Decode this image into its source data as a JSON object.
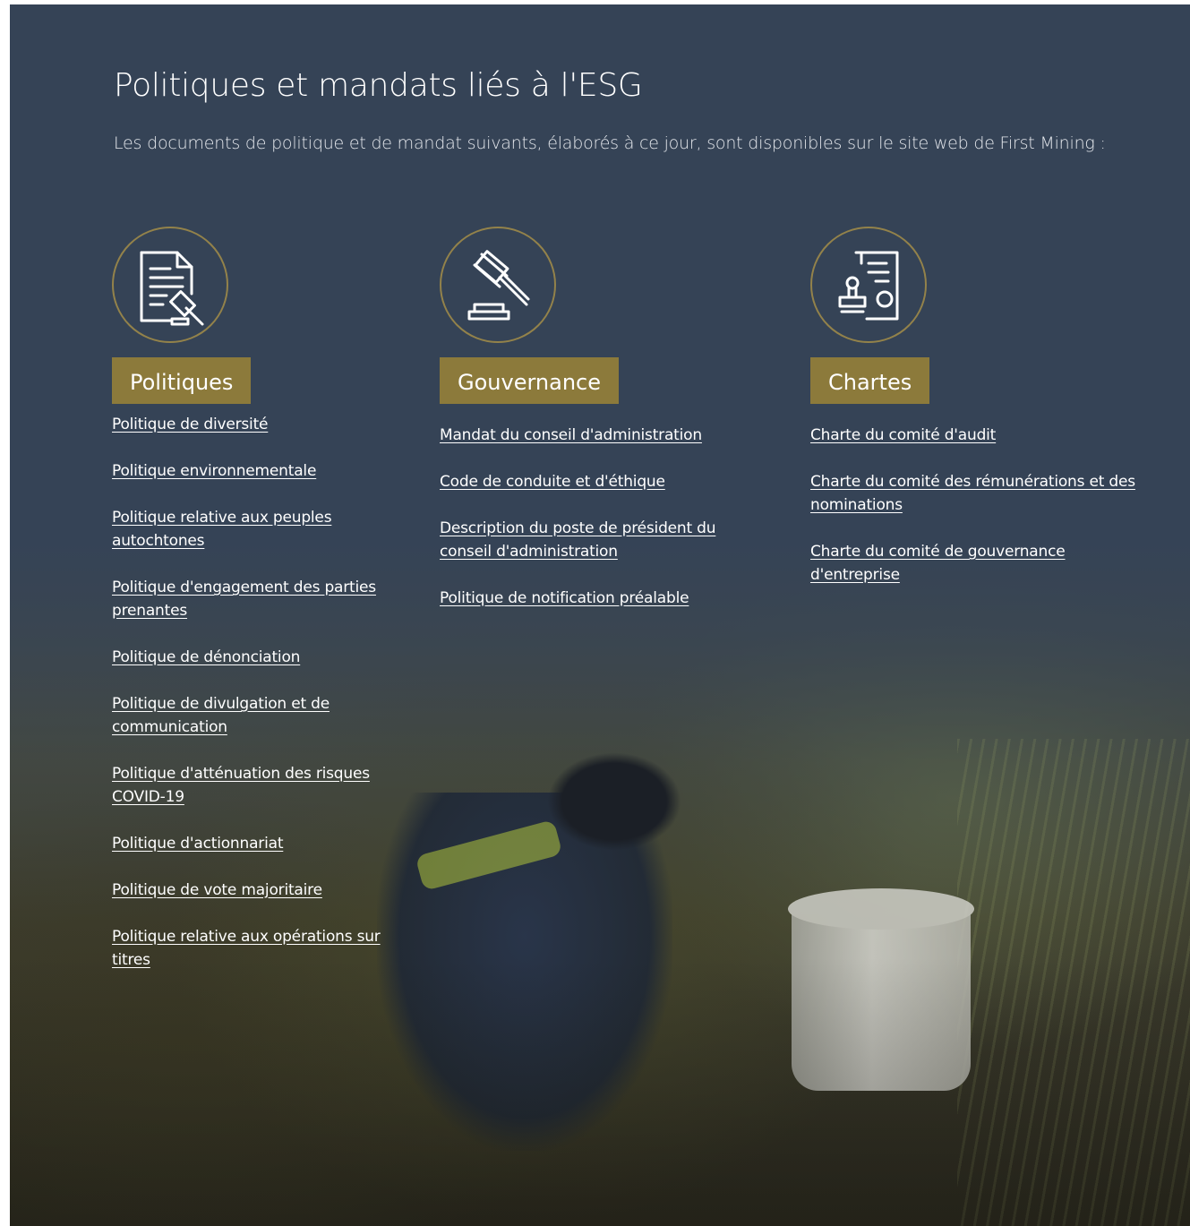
{
  "section": {
    "title": "Politiques et mandats liés à l'ESG",
    "intro": "Les documents de politique et de mandat suivants, élaborés à ce jour, sont disponibles sur le site web de First Mining :"
  },
  "accent_color": "#8c7a3b",
  "background_color": "#354356",
  "columns": [
    {
      "icon": "document-gavel-icon",
      "heading": "Politiques",
      "links": [
        "Politique de diversité",
        "Politique environnementale",
        "Politique relative aux peuples autochtones",
        "Politique d'engagement des parties prenantes",
        "Politique de dénonciation",
        "Politique de divulgation et de communication",
        "Politique d'atténuation des risques COVID-19",
        "Politique d'actionnariat",
        "Politique de vote majoritaire",
        "Politique relative aux opérations sur titres"
      ]
    },
    {
      "icon": "gavel-icon",
      "heading": "Gouvernance",
      "links": [
        "Mandat du conseil d'administration",
        "Code de conduite et d'éthique",
        "Description du poste de président du conseil d'administration",
        "Politique de notification préalable"
      ]
    },
    {
      "icon": "stamped-charter-icon",
      "heading": "Chartes",
      "links": [
        "Charte du comité d'audit",
        "Charte du comité des rémunérations et des nominations",
        "Charte du comité de gouvernance d'entreprise"
      ]
    }
  ]
}
